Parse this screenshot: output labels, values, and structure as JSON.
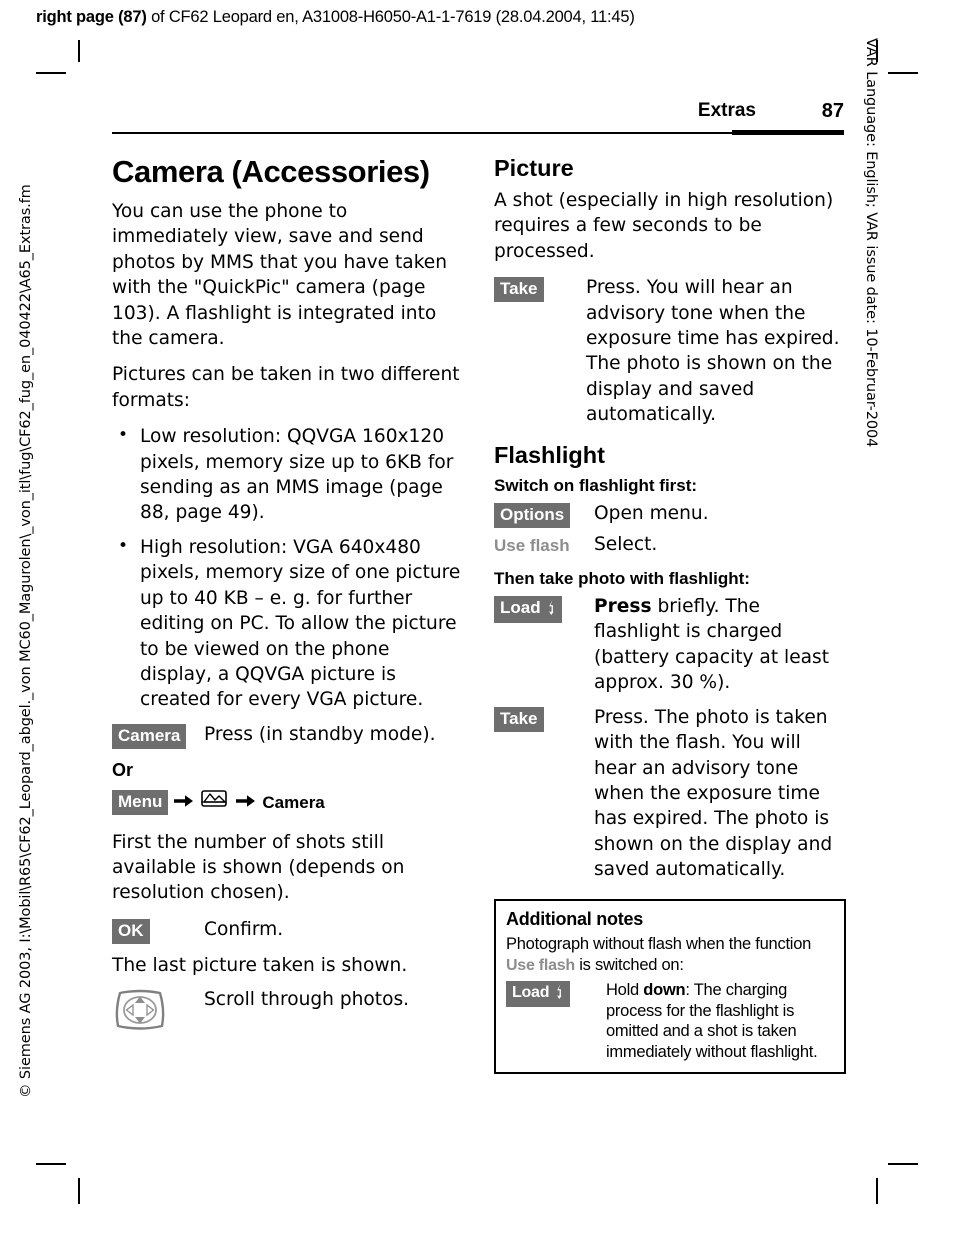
{
  "topline": {
    "bold_prefix": "right page (87)",
    "rest": " of CF62 Leopard en, A31008-H6050-A1-1-7619 (28.04.2004, 11:45)"
  },
  "margins": {
    "left_text": "© Siemens AG 2003, I:\\Mobil\\R65\\CF62_Leopard_abgel._von MC60_Magurolen\\_von_itl\\fug\\CF62_fug_en_040422\\A65_Extras.fm",
    "right_text": "VAR Language: English; VAR issue date: 10-Februar-2004"
  },
  "running_head": {
    "title": "Extras",
    "page_number": "87"
  },
  "left_column": {
    "title": "Camera (Accessories)",
    "intro": "You can use the phone to immediately view, save and send photos by MMS that you have taken with the \"QuickPic\" camera (page 103). A flashlight is integrated into the camera.",
    "formats_lead": "Pictures can be taken in two different formats:",
    "bullets": [
      "Low resolution:\nQQVGA 160x120 pixels, memory size up to 6KB for sending as an MMS image (page 88, page 49).",
      "High resolution:\nVGA 640x480 pixels, memory size of one picture up to 40 KB – e. g. for further editing on PC. To allow the picture to be viewed on the phone display, a QQVGA picture is created for every VGA picture."
    ],
    "camera_key": "Camera",
    "camera_desc": "Press (in standby mode).",
    "or_label": "Or",
    "menu_key": "Menu",
    "menu_target": "Camera",
    "shots_para": "First the number of shots still available is shown (depends on resolution chosen).",
    "ok_key": "OK",
    "ok_desc": "Confirm.",
    "last_picture_para": "The last picture taken is shown.",
    "scroll_desc": "Scroll through photos."
  },
  "right_column": {
    "picture_heading": "Picture",
    "picture_para": "A shot (especially in high resolution) requires a few seconds to be processed.",
    "take_key": "Take",
    "take_desc": "Press. You will hear an advisory tone when the exposure time has expired. The photo is shown on the display and saved automatically.",
    "flashlight_heading": "Flashlight",
    "switch_on_sub": "Switch on flashlight first:",
    "options_key": "Options",
    "options_desc": "Open menu.",
    "use_flash_item": "Use flash",
    "use_flash_desc": "Select.",
    "then_take_sub": "Then take photo with flashlight:",
    "load_key": "Load",
    "load_desc_bold": "Press",
    "load_desc_rest": " briefly. The flashlight is charged (battery capacity at least approx. 30 %).",
    "take2_key": "Take",
    "take2_desc": "Press. The photo is taken with the flash. You will hear an advisory tone when the exposure time has expired. The photo is shown on the display and saved automatically."
  },
  "notes": {
    "heading": "Additional notes",
    "line1_a": "Photograph without flash when the function ",
    "line1_menu": "Use flash",
    "line1_b": " is switched on:",
    "load_key": "Load",
    "desc_a": "Hold ",
    "desc_bold": "down",
    "desc_b": ": The charging process for the flashlight is omitted and a shot is taken immediately without flashlight."
  },
  "icons": {
    "softkey_bg": "#6e6e6e",
    "menu_text_color": "#8d8d8d"
  }
}
